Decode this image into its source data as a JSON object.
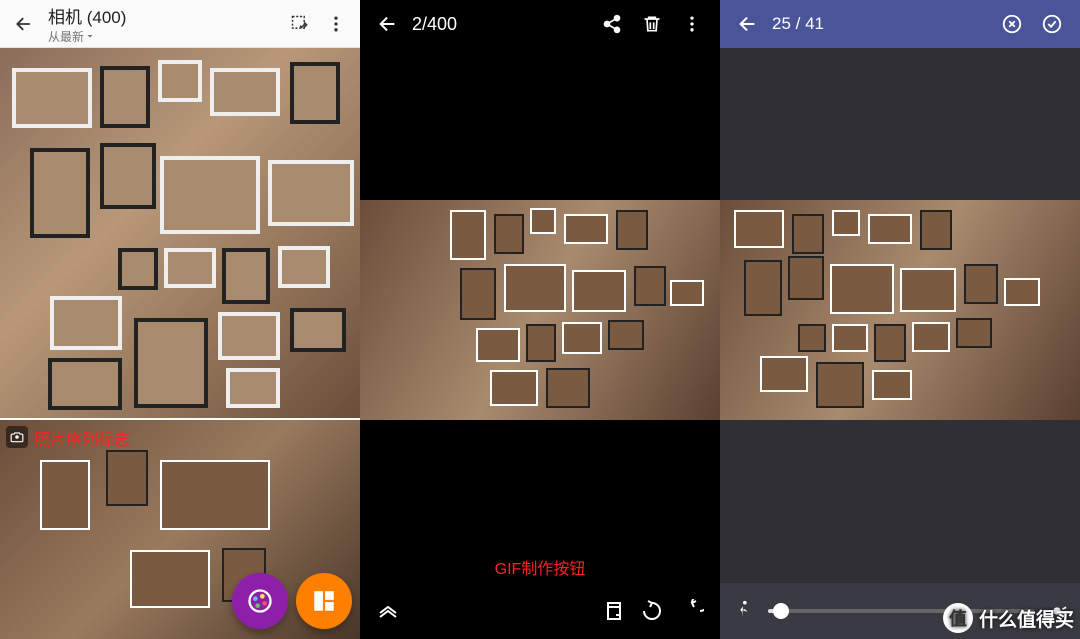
{
  "panel1": {
    "title": "相机 (400)",
    "subtitle": "从最新",
    "annotation": "照片序列标志"
  },
  "panel2": {
    "counter": "2/400",
    "annotation": "GIF制作按钮"
  },
  "panel3": {
    "counter": "25 / 41"
  },
  "watermark": {
    "badge": "值",
    "text": "什么值得买"
  }
}
